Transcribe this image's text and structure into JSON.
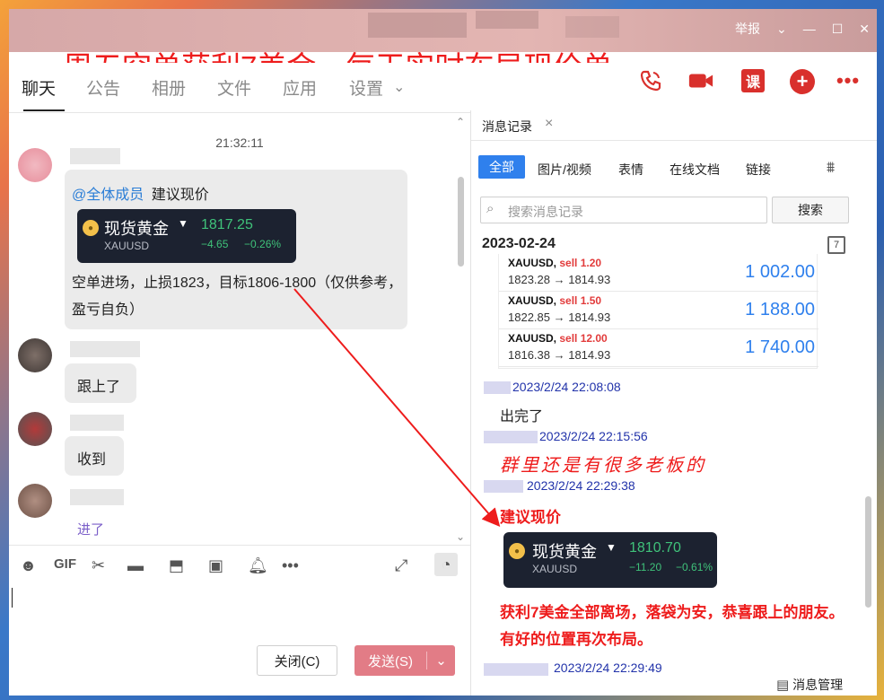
{
  "window": {
    "report_label": "举报",
    "headline": "周五空单获利7美金，每天实时布局现价单"
  },
  "tabs": [
    {
      "label": "聊天",
      "active": true
    },
    {
      "label": "公告"
    },
    {
      "label": "相册"
    },
    {
      "label": "文件"
    },
    {
      "label": "应用"
    },
    {
      "label": "设置"
    }
  ],
  "top_icons": [
    "phone-icon",
    "video-icon",
    "course-icon",
    "add-icon",
    "more-icon"
  ],
  "course_label": "课",
  "chat": {
    "timestamp": "21:32:11",
    "msg1": {
      "mention": "@全体成员",
      "text_after_mention": "建议现价",
      "card": {
        "name": "现货黄金",
        "symbol": "XAUUSD",
        "price": "1817.25",
        "change": "−4.65",
        "pct": "−0.26%"
      },
      "body": "空单进场，止损1823，目标1806-1800（仅供参考，盈亏自负）"
    },
    "msg2": "跟上了",
    "msg3": "收到",
    "msg4": "进了"
  },
  "composer": {
    "close_label": "关闭(C)",
    "send_label": "发送(S)"
  },
  "history": {
    "title": "消息记录",
    "filters": [
      "全部",
      "图片/视频",
      "表情",
      "在线文档",
      "链接"
    ],
    "search_placeholder": "搜索消息记录",
    "search_button": "搜索",
    "date": "2023-02-24",
    "calendar_day": "7",
    "trades": [
      {
        "symbol": "XAUUSD",
        "side": "sell 1.20",
        "prices": "1823.28 → 1814.93",
        "profit": "1 002.00"
      },
      {
        "symbol": "XAUUSD",
        "side": "sell 1.50",
        "prices": "1822.85 → 1814.93",
        "profit": "1 188.00"
      },
      {
        "symbol": "XAUUSD",
        "side": "sell 12.00",
        "prices": "1816.38 → 1814.93",
        "profit": "1 740.00"
      }
    ],
    "entries": [
      {
        "time": "2023/2/24 22:08:08",
        "text": "出完了"
      },
      {
        "time": "2023/2/24 22:15:56",
        "text": "群里还是有很多老板的"
      },
      {
        "time": "2023/2/24 22:29:38",
        "text": "建议现价"
      },
      {
        "time": "2023/2/24 22:29:49"
      }
    ],
    "card2": {
      "name": "现货黄金",
      "symbol": "XAUUSD",
      "price": "1810.70",
      "change": "−11.20",
      "pct": "−0.61%"
    },
    "note": "获利7美金全部离场，落袋为安，恭喜跟上的朋友。有好的位置再次布局。",
    "manage_label": "消息管理"
  }
}
